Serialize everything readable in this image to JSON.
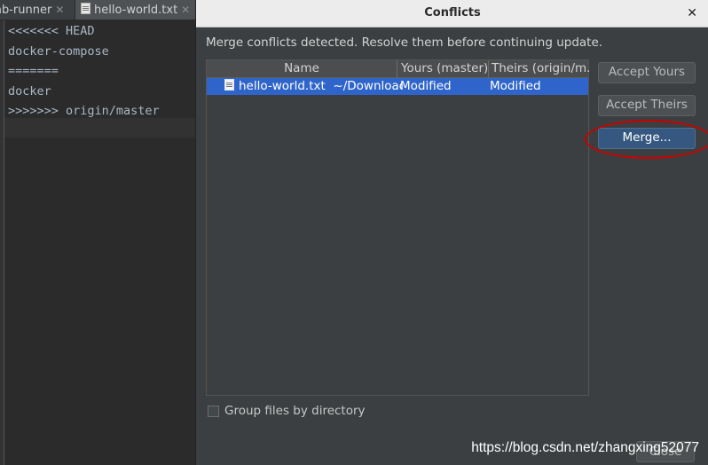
{
  "editor": {
    "tabs": [
      {
        "label": "ab-runner"
      },
      {
        "label": "hello-world.txt"
      }
    ],
    "code_lines": [
      "<<<<<<< HEAD",
      "docker-compose",
      "=======",
      "docker",
      ">>>>>>> origin/master"
    ]
  },
  "dialog": {
    "title": "Conflicts",
    "message": "Merge conflicts detected. Resolve them before continuing update.",
    "columns": {
      "name": "Name",
      "yours": "Yours (master)",
      "theirs": "Theirs (origin/m..."
    },
    "rows": [
      {
        "file": "hello-world.txt",
        "path": "~/Downloads",
        "yours": "Modified",
        "theirs": "Modified"
      }
    ],
    "buttons": {
      "accept_yours": "Accept Yours",
      "accept_theirs": "Accept Theirs",
      "merge": "Merge...",
      "close": "Close"
    },
    "group_by_directory": {
      "label": "Group files by directory",
      "checked": false
    }
  },
  "watermark": "https://blog.csdn.net/zhangxing52077",
  "colors": {
    "selection": "#2f65ca",
    "highlight_ring": "#cc0000",
    "merge_button": "#365880"
  }
}
